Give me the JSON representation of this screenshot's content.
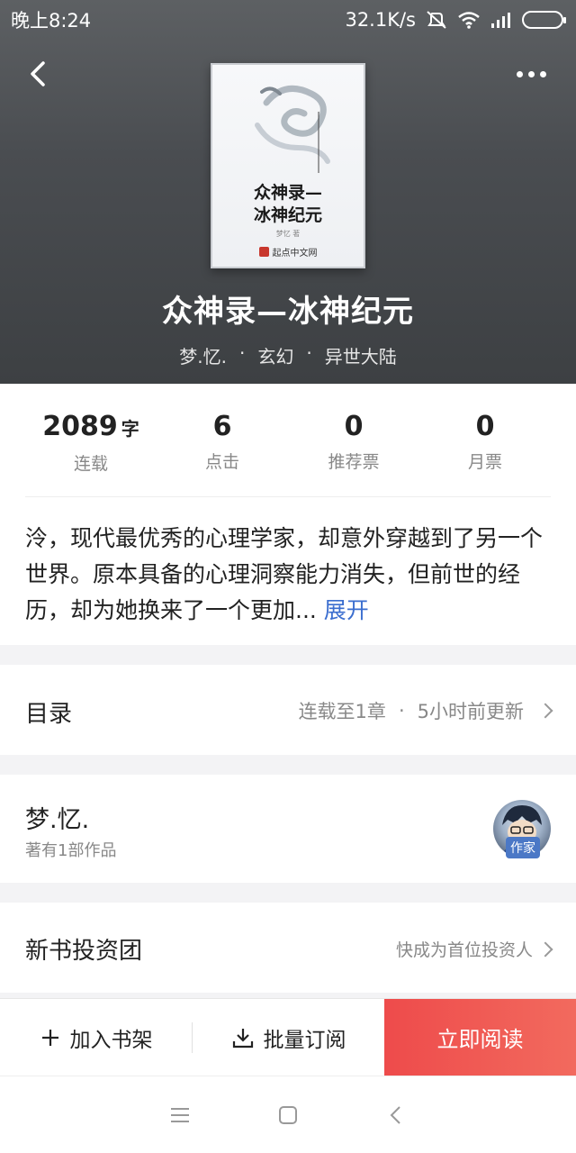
{
  "status_bar": {
    "time": "晚上8:24",
    "net_speed": "32.1K/s",
    "icons": [
      "mute-icon",
      "wifi-icon",
      "signal-icon",
      "battery-icon"
    ]
  },
  "header": {
    "back_icon": "chevron-left-icon",
    "more_icon": "more-dots-icon"
  },
  "cover": {
    "title_line1": "众神录—",
    "title_line2": "冰神纪元",
    "author": "梦忆 著",
    "publisher": "起点中文网"
  },
  "book": {
    "title": "众神录—冰神纪元",
    "author": "梦.忆.",
    "genre": "玄幻",
    "subgenre": "异世大陆",
    "separator": "·"
  },
  "stats": [
    {
      "value": "2089",
      "unit": "字",
      "label": "连载"
    },
    {
      "value": "6",
      "unit": "",
      "label": "点击"
    },
    {
      "value": "0",
      "unit": "",
      "label": "推荐票"
    },
    {
      "value": "0",
      "unit": "",
      "label": "月票"
    }
  ],
  "intro": {
    "text": "泠，现代最优秀的心理学家，却意外穿越到了另一个世界。原本具备的心理洞察能力消失，但前世的经历，却为她换来了一个更加...",
    "expand_label": "展开"
  },
  "toc": {
    "title": "目录",
    "status": "连载至1章",
    "separator": "·",
    "update": "5小时前更新"
  },
  "author_card": {
    "name": "梦.忆.",
    "works": "著有1部作品",
    "badge": "作家"
  },
  "invest": {
    "title": "新书投资团",
    "hint": "快成为首位投资人"
  },
  "actions": {
    "add_shelf": "加入书架",
    "batch_subscribe": "批量订阅",
    "read_now": "立即阅读"
  },
  "colors": {
    "header_bg": "#4a4d51",
    "accent_link": "#3b6ecf",
    "read_button": "#ee4b4b",
    "badge": "#4b78c6"
  }
}
